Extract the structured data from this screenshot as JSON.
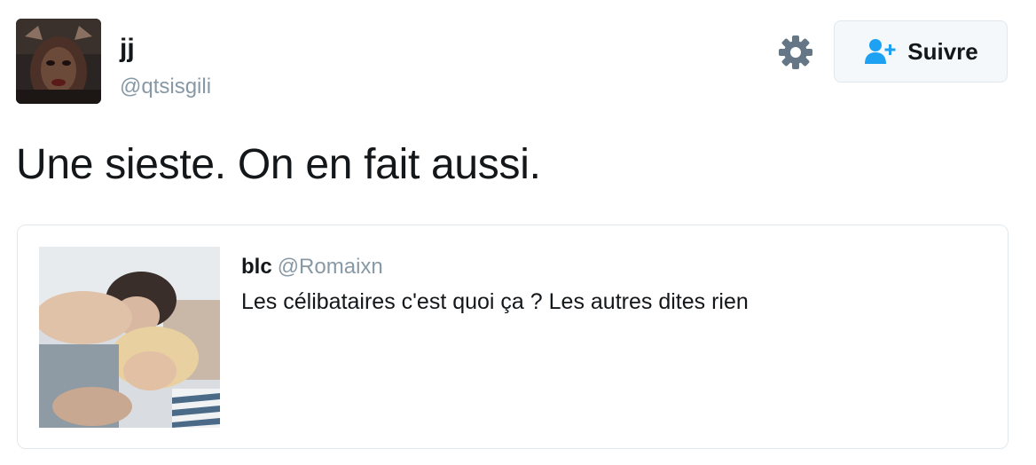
{
  "author": {
    "display_name": "jj",
    "screen_name": "@qtsisgili",
    "avatar_icon": "avatar-photo"
  },
  "actions": {
    "settings_icon": "gear-icon",
    "follow_icon": "follow-user-icon",
    "follow_label": "Suivre"
  },
  "tweet": {
    "text": "Une sieste. On en fait aussi."
  },
  "quoted_tweet": {
    "display_name": "blc",
    "screen_name": "@Romaixn",
    "text": "Les célibataires c'est quoi ça ? Les autres dites rien",
    "media_icon": "photo-thumbnail"
  },
  "colors": {
    "text": "#14171a",
    "secondary": "#8899a6",
    "accent": "#1da1f2",
    "border": "#e1e8ed",
    "button_bg": "#f5f8fa"
  }
}
